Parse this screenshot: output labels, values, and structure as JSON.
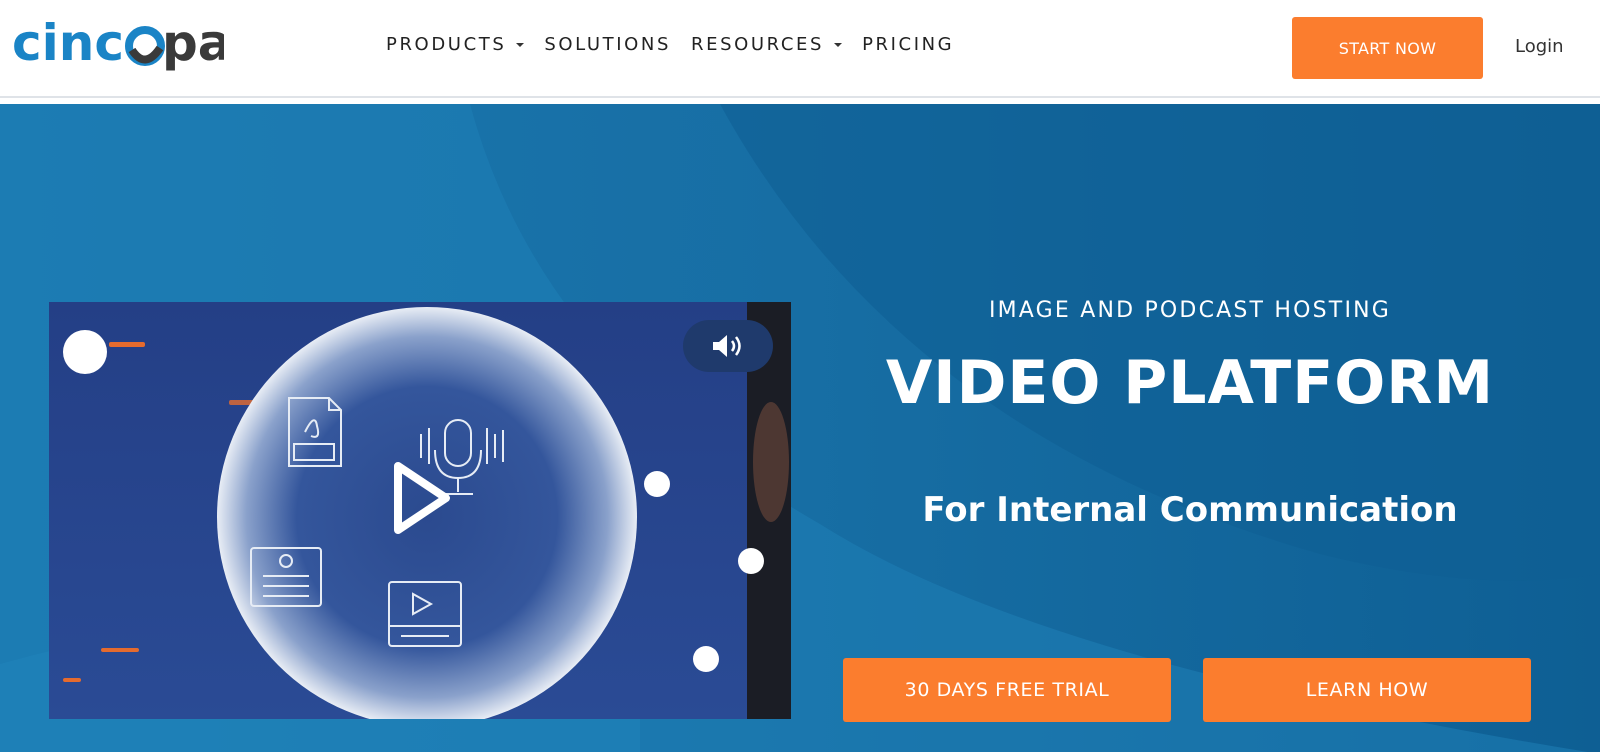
{
  "brand": {
    "name": "cincopa",
    "part1": "cinc",
    "part2": "pa"
  },
  "nav": {
    "items": [
      {
        "label": "PRODUCTS",
        "has_dropdown": true
      },
      {
        "label": "SOLUTIONS",
        "has_dropdown": false
      },
      {
        "label": "RESOURCES",
        "has_dropdown": true
      },
      {
        "label": "PRICING",
        "has_dropdown": false
      }
    ],
    "start_label": "START NOW",
    "login_label": "Login"
  },
  "hero": {
    "eyebrow": "IMAGE AND PODCAST HOSTING",
    "headline": "VIDEO PLATFORM",
    "subhead": "For Internal Communication",
    "cta_trial": "30 DAYS FREE TRIAL",
    "cta_learn": "LEARN HOW"
  },
  "video": {
    "icons": [
      "pdf-icon",
      "microphone-icon",
      "document-icon",
      "video-icon"
    ],
    "controls": [
      "play-icon",
      "volume-icon"
    ]
  },
  "colors": {
    "accent": "#fb7d2e",
    "hero_bg": "#176ea4",
    "logo_blue": "#1a84c6",
    "logo_dark": "#3a3a3a"
  }
}
